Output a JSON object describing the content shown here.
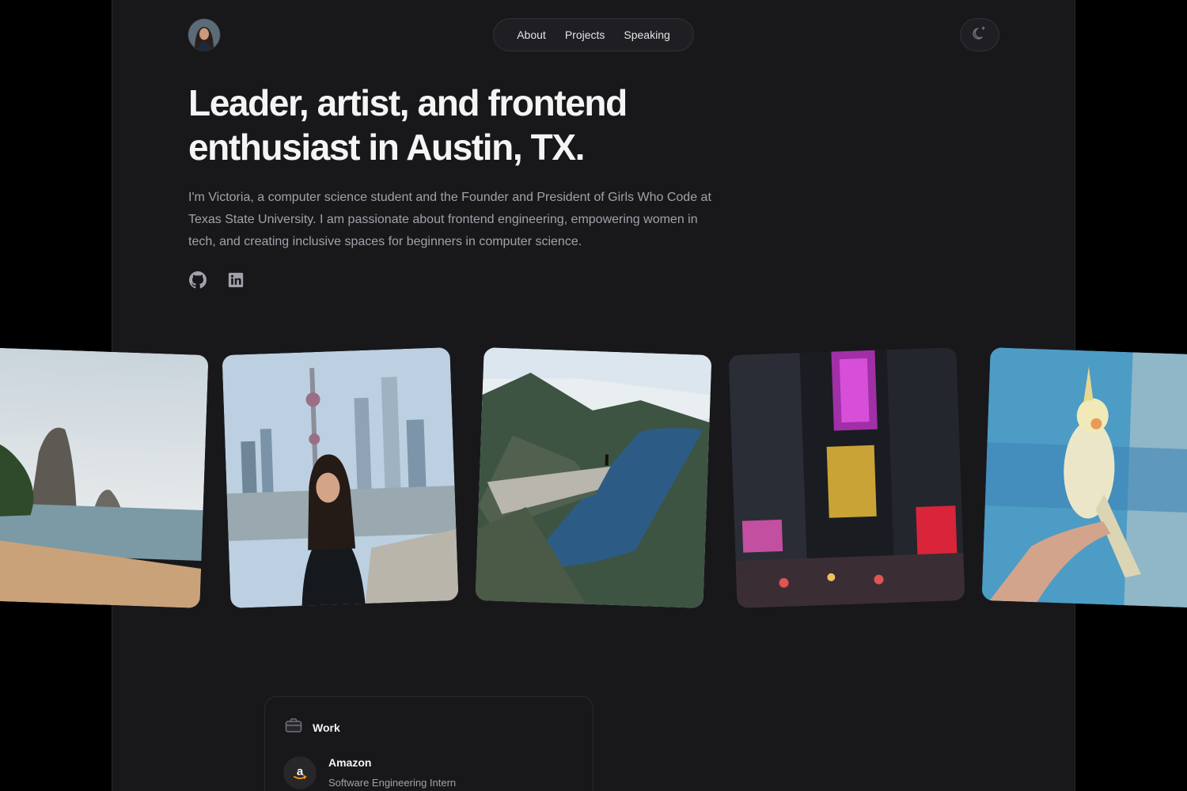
{
  "header": {
    "nav": [
      {
        "label": "About"
      },
      {
        "label": "Projects"
      },
      {
        "label": "Speaking"
      }
    ]
  },
  "hero": {
    "title_line1": "Leader, artist, and frontend",
    "title_line2": "enthusiast in Austin, TX.",
    "intro": "I'm Victoria, a computer science student and the Founder and President of Girls Who Code at Texas State University. I am passionate about frontend engineering, empowering women in tech, and creating inclusive spaces for beginners in computer science."
  },
  "socials": [
    {
      "icon": "github-icon"
    },
    {
      "icon": "linkedin-icon"
    }
  ],
  "photos": [
    {
      "subject": "beach-with-limestone-cliffs"
    },
    {
      "subject": "woman-in-front-of-city-skyline"
    },
    {
      "subject": "person-on-cliff-over-fjord"
    },
    {
      "subject": "neon-city-street-at-night"
    },
    {
      "subject": "cockatiel-on-hand"
    }
  ],
  "work": {
    "heading": "Work",
    "jobs": [
      {
        "company": "Amazon",
        "role": "Software Engineering Intern"
      }
    ]
  },
  "colors": {
    "page_background": "#000000",
    "panel_background": "#18181b",
    "heading_text": "#f4f4f5",
    "body_text": "#a1a1aa"
  }
}
